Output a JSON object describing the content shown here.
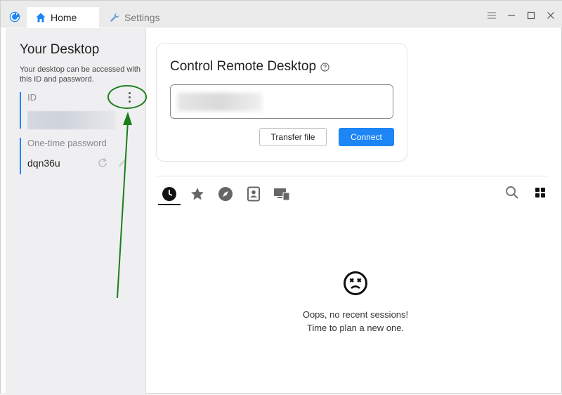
{
  "window": {
    "tabs": [
      {
        "label": "Home",
        "icon": "home-icon",
        "active": true
      },
      {
        "label": "Settings",
        "icon": "wrench-icon",
        "active": false
      }
    ],
    "accent_color": "#1e85f5"
  },
  "sidebar": {
    "title": "Your Desktop",
    "description": "Your desktop can be accessed with this ID and password.",
    "id_label": "ID",
    "password_label": "One-time password",
    "password_value": "dqn36u"
  },
  "control": {
    "title": "Control Remote Desktop",
    "transfer_label": "Transfer file",
    "connect_label": "Connect"
  },
  "peers": {
    "tabs": [
      "recent-icon",
      "favorites-icon",
      "discovered-icon",
      "address-book-icon",
      "group-icon"
    ],
    "empty_line1": "Oops, no recent sessions!",
    "empty_line2": "Time to plan a new one."
  },
  "annotation": {
    "color": "#1a7f1a"
  }
}
